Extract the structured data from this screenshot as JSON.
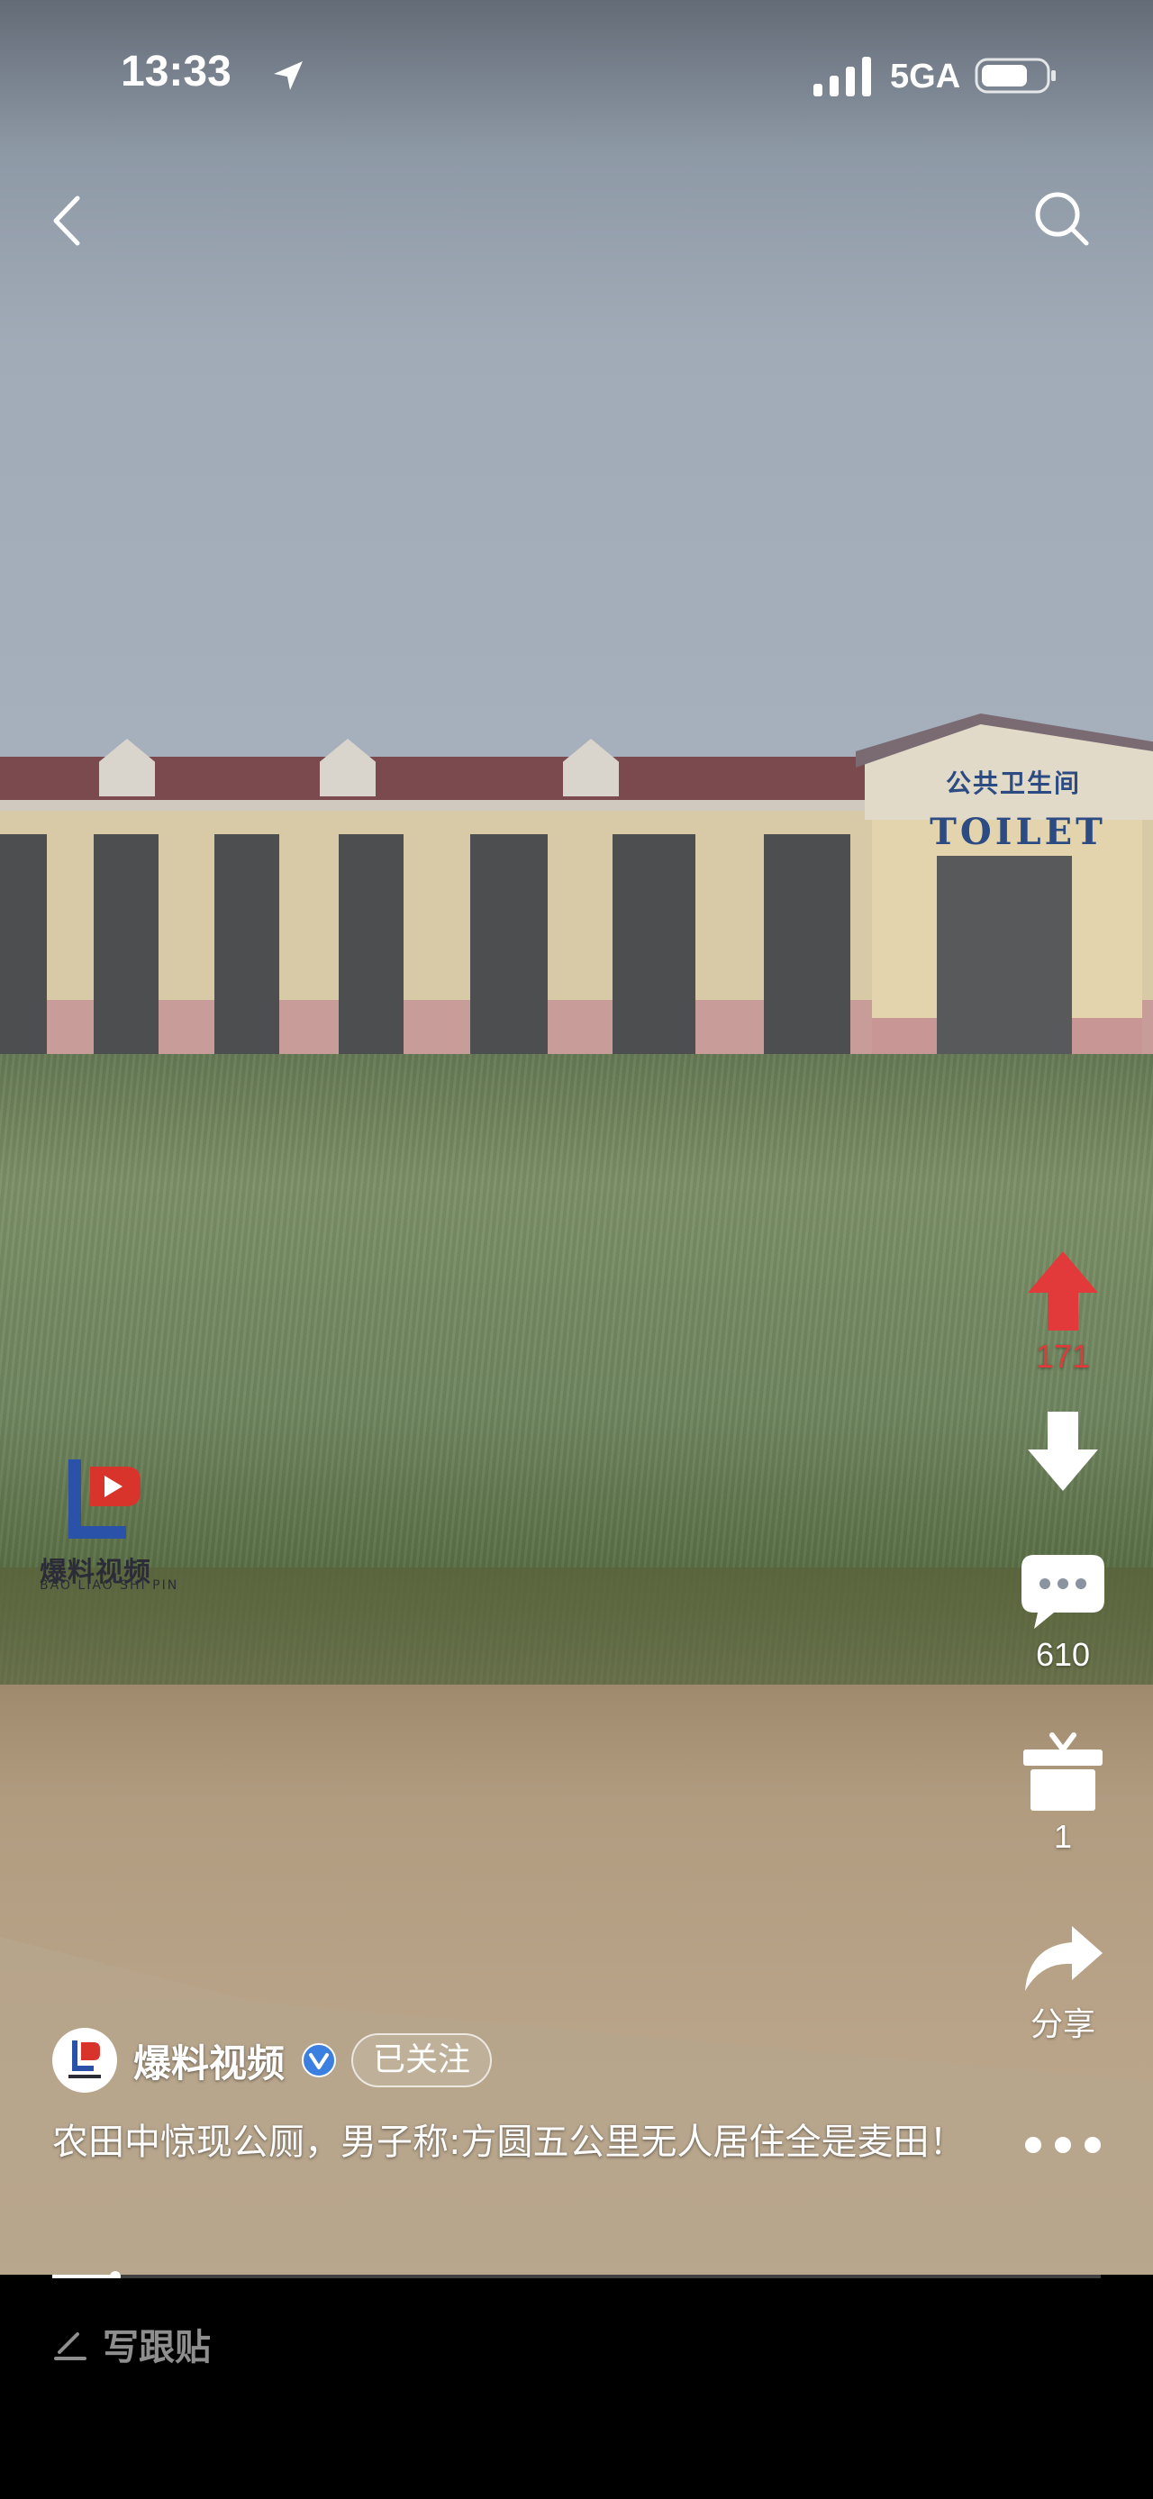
{
  "status_bar": {
    "time": "13:33",
    "network": "5GA"
  },
  "video": {
    "sign_cn": "公共卫生间",
    "sign_en": "TOILET",
    "watermark_cn": "爆料视频",
    "watermark_en": "BAO LIAO SHI PIN",
    "progress": 0.06
  },
  "rail": {
    "upvote_count": "171",
    "comment_count": "610",
    "gift_count": "1",
    "share_label": "分享"
  },
  "author": {
    "name": "爆料视频",
    "follow_label": "已关注"
  },
  "caption": "农田中惊现公厕，男子称:方圆五公里无人居住全是麦田！",
  "bottom": {
    "reply_label": "写跟贴"
  },
  "colors": {
    "upvote_red": "#e23a3a",
    "verified_blue": "#3b7fe0",
    "background": "#000000"
  }
}
